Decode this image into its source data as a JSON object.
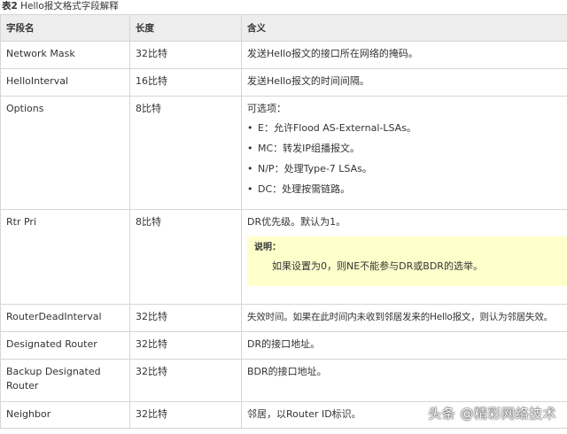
{
  "caption": {
    "prefix": "表2",
    "title": "Hello报文格式字段解释"
  },
  "headers": [
    "字段名",
    "长度",
    "含义"
  ],
  "rows": [
    {
      "field": "Network Mask",
      "length": "32比特",
      "meaning": "发送Hello报文的接口所在网络的掩码。"
    },
    {
      "field": "HelloInterval",
      "length": "16比特",
      "meaning": "发送Hello报文的时间间隔。"
    },
    {
      "field": "Options",
      "length": "8比特",
      "meaning": "可选项：",
      "items": [
        "E：允许Flood AS-External-LSAs。",
        "MC：转发IP组播报文。",
        "N/P：处理Type-7 LSAs。",
        "DC：处理按需链路。"
      ]
    },
    {
      "field": "Rtr Pri",
      "length": "8比特",
      "meaning": "DR优先级。默认为1。",
      "note": {
        "title": "说明：",
        "text": "如果设置为0，则NE不能参与DR或BDR的选举。"
      }
    },
    {
      "field": "RouterDeadInterval",
      "length": "32比特",
      "meaning": "失效时间。如果在此时间内未收到邻居发来的Hello报文，则认为邻居失效。"
    },
    {
      "field": "Designated Router",
      "length": "32比特",
      "meaning": "DR的接口地址。"
    },
    {
      "field": "Backup Designated Router",
      "length": "32比特",
      "meaning": "BDR的接口地址。"
    },
    {
      "field": "Neighbor",
      "length": "32比特",
      "meaning": "邻居，以Router ID标识。"
    }
  ],
  "watermark": "头条 @精彩网络技术"
}
